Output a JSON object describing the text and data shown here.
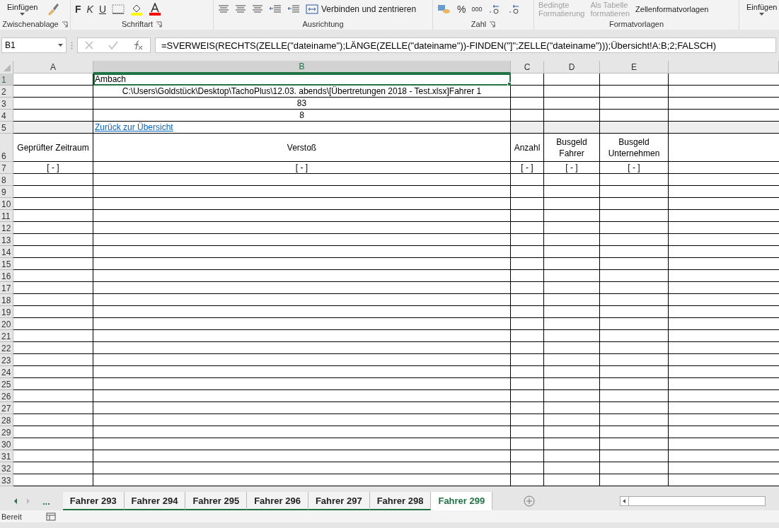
{
  "ribbon": {
    "groups": [
      {
        "label": "Zwischenablage",
        "button": "Einfügen"
      },
      {
        "label": "Schriftart",
        "format_buttons": [
          "F",
          "K",
          "U"
        ]
      },
      {
        "label": "Ausrichtung",
        "merge": "Verbinden und zentrieren"
      },
      {
        "label": "Zahl",
        "format_buttons": [
          "%",
          "000"
        ]
      },
      {
        "label": "Formatvorlagen",
        "buttons": [
          {
            "lines": [
              "Bedingte",
              "Formatierung"
            ],
            "disabled": true
          },
          {
            "lines": [
              "Als Tabelle",
              "formatieren"
            ],
            "disabled": true
          },
          {
            "lines": [
              "Zellenformatvorlagen"
            ],
            "disabled": false
          }
        ]
      },
      {
        "button": "Einfügen"
      }
    ]
  },
  "formula_bar": {
    "name_box": "B1",
    "formula": "=SVERWEIS(RECHTS(ZELLE(\"dateiname\");LÄNGE(ZELLE(\"dateiname\"))-FINDEN(\"]\";ZELLE(\"dateiname\")));Übersicht!A:B;2;FALSCH)"
  },
  "columns": [
    {
      "label": "A",
      "selected": false
    },
    {
      "label": "B",
      "selected": true
    },
    {
      "label": "C",
      "selected": false
    },
    {
      "label": "D",
      "selected": false
    },
    {
      "label": "E",
      "selected": false
    }
  ],
  "rows": [
    {
      "number": "1",
      "cells": [
        {
          "selected": false
        },
        {
          "text": "Ambach",
          "selected": true
        },
        {
          "selected": false
        },
        {
          "selected": false
        },
        {
          "selected": false
        }
      ]
    },
    {
      "number": "2",
      "cells": [
        {
          "selected": false
        },
        {
          "text": "C:\\Users\\Goldstück\\Desktop\\TachoPlus\\12.03. abends\\[Übertretungen 2018 - Test.xlsx]Fahrer 1",
          "selected": false
        },
        {
          "selected": false
        },
        {
          "selected": false
        },
        {
          "selected": false
        }
      ]
    },
    {
      "number": "3",
      "cells": [
        {
          "selected": false
        },
        {
          "text": "83",
          "selected": false
        },
        {
          "selected": false
        },
        {
          "selected": false
        },
        {
          "selected": false
        }
      ]
    },
    {
      "number": "4",
      "cells": [
        {
          "selected": false
        },
        {
          "text": "8",
          "selected": false
        },
        {
          "selected": false
        },
        {
          "selected": false
        },
        {
          "selected": false
        }
      ]
    },
    {
      "number": "5",
      "kind": "shaded",
      "cells": [
        {
          "selected": false
        },
        {
          "text": "Zurück zur Übersicht",
          "kind": "link",
          "selected": false
        },
        {
          "selected": false
        },
        {
          "selected": false
        },
        {
          "selected": false
        }
      ]
    },
    {
      "number": "6",
      "kind": "header",
      "cells": [
        {
          "text": "Geprüfter Zeitraum",
          "selected": false
        },
        {
          "text": "Verstoß",
          "selected": false
        },
        {
          "text": "Anzahl",
          "selected": false
        },
        {
          "text": "Busgeld Fahrer",
          "selected": false
        },
        {
          "text": "Busgeld Unternehmen",
          "selected": false
        }
      ]
    },
    {
      "number": "7",
      "cells": [
        {
          "text": "[ - ]",
          "selected": false
        },
        {
          "text": "[ - ]",
          "selected": false
        },
        {
          "text": "[ - ]",
          "selected": false
        },
        {
          "text": "[ - ]",
          "selected": false
        },
        {
          "text": "[ - ]",
          "selected": false
        }
      ]
    }
  ],
  "empty_rows": [
    "8",
    "9",
    "10",
    "11",
    "12",
    "13",
    "14",
    "15",
    "16",
    "17",
    "18",
    "19",
    "20",
    "21",
    "22",
    "23",
    "24",
    "25",
    "26",
    "27",
    "28",
    "29",
    "30",
    "31",
    "32",
    "33"
  ],
  "sheet_tabs": {
    "more": "...",
    "tabs": [
      {
        "label": "Fahrer 293",
        "selected": false
      },
      {
        "label": "Fahrer 294",
        "selected": false
      },
      {
        "label": "Fahrer 295",
        "selected": false
      },
      {
        "label": "Fahrer 296",
        "selected": false
      },
      {
        "label": "Fahrer 297",
        "selected": false
      },
      {
        "label": "Fahrer 298",
        "selected": false
      },
      {
        "label": "Fahrer 299",
        "selected": true
      }
    ]
  },
  "status_bar": {
    "text": "Bereit"
  }
}
